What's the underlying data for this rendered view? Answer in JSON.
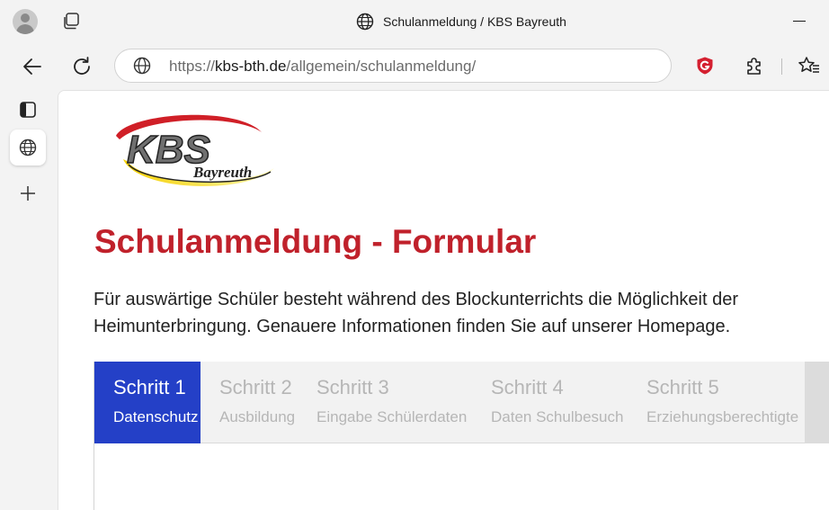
{
  "browser": {
    "window_title": "Schulanmeldung / KBS Bayreuth",
    "url_prefix": "https://",
    "url_domain": "kbs-bth.de",
    "url_path": "/allgemein/schulanmeldung/"
  },
  "page": {
    "logo_text_main": "KBS",
    "logo_text_sub": "Bayreuth",
    "title": "Schulanmeldung - Formular",
    "intro_line1": "Für auswärtige Schüler besteht während des Blockunterrichts die Möglichkeit der",
    "intro_line2": "Heimunterbringung. Genauere Informationen finden Sie auf unserer Homepage."
  },
  "steps": [
    {
      "label": "Schritt 1",
      "sub": "Datenschutz",
      "active": true
    },
    {
      "label": "Schritt 2",
      "sub": "Ausbildung",
      "active": false
    },
    {
      "label": "Schritt 3",
      "sub": "Eingabe Schülerdaten",
      "active": false
    },
    {
      "label": "Schritt 4",
      "sub": "Daten Schulbesuch",
      "active": false
    },
    {
      "label": "Schritt 5",
      "sub": "Erziehungsberechtigte",
      "active": false
    }
  ],
  "colors": {
    "title_red": "#c0212b",
    "step_active": "#2440c7",
    "step_inactive_text": "#b6b6b6"
  }
}
